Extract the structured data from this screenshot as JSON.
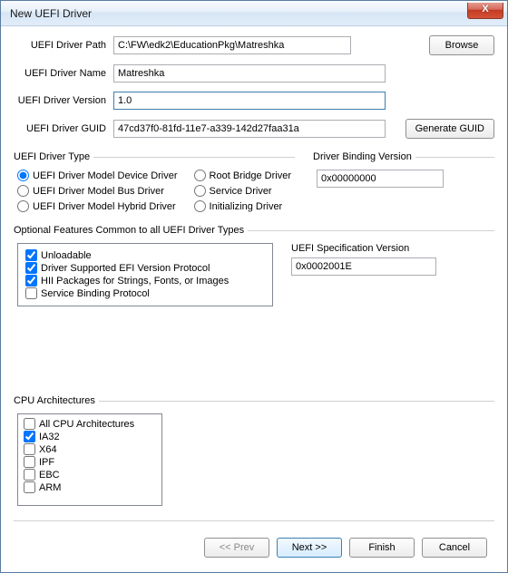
{
  "window": {
    "title": "New UEFI Driver"
  },
  "labels": {
    "path": "UEFI Driver Path",
    "name": "UEFI Driver Name",
    "version": "UEFI Driver Version",
    "guid": "UEFI Driver GUID",
    "driverType": "UEFI Driver Type",
    "bindingVersion": "Driver Binding Version",
    "optionalFeatures": "Optional Features Common to all UEFI Driver Types",
    "specVersion": "UEFI Specification Version",
    "cpuArch": "CPU Architectures"
  },
  "fields": {
    "path": "C:\\FW\\edk2\\EducationPkg\\Matreshka",
    "name": "Matreshka",
    "version": "1.0",
    "guid": "47cd37f0-81fd-11e7-a339-142d27faa31a",
    "bindingVersion": "0x00000000",
    "specVersion": "0x0002001E"
  },
  "buttons": {
    "browse": "Browse",
    "generateGuid": "Generate GUID",
    "prev": "<< Prev",
    "next": "Next >>",
    "finish": "Finish",
    "cancel": "Cancel",
    "close": "X"
  },
  "driverTypes": {
    "deviceDriver": "UEFI Driver Model Device Driver",
    "busDriver": "UEFI Driver Model Bus Driver",
    "hybridDriver": "UEFI Driver Model Hybrid Driver",
    "rootBridge": "Root Bridge Driver",
    "serviceDriver": "Service Driver",
    "initializing": "Initializing Driver"
  },
  "optional": {
    "unloadable": "Unloadable",
    "efiVersion": "Driver Supported EFI Version Protocol",
    "hii": "HII Packages for Strings, Fonts, or Images",
    "serviceBinding": "Service Binding Protocol"
  },
  "cpu": {
    "all": "All CPU Architectures",
    "ia32": "IA32",
    "x64": "X64",
    "ipf": "IPF",
    "ebc": "EBC",
    "arm": "ARM"
  }
}
